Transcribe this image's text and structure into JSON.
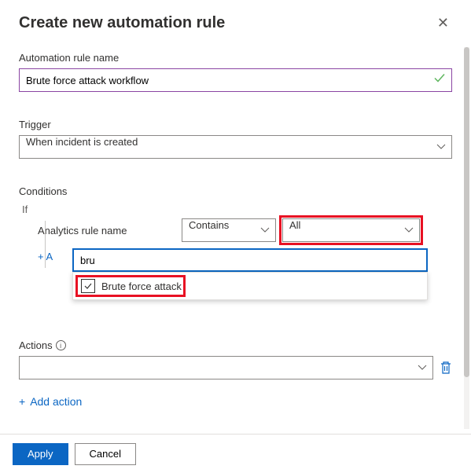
{
  "header": {
    "title": "Create new automation rule"
  },
  "rule_name": {
    "label": "Automation rule name",
    "value": "Brute force attack workflow"
  },
  "trigger": {
    "label": "Trigger",
    "value": "When incident is created"
  },
  "conditions": {
    "label": "Conditions",
    "if_label": "If",
    "rule_label": "Analytics rule name",
    "operator": "Contains",
    "match_value": "All",
    "search_value": "bru",
    "dropdown_option": "Brute force attack",
    "add_link": "+ A"
  },
  "actions": {
    "label": "Actions",
    "selected": "",
    "add_label": "Add action"
  },
  "footer": {
    "apply": "Apply",
    "cancel": "Cancel"
  }
}
